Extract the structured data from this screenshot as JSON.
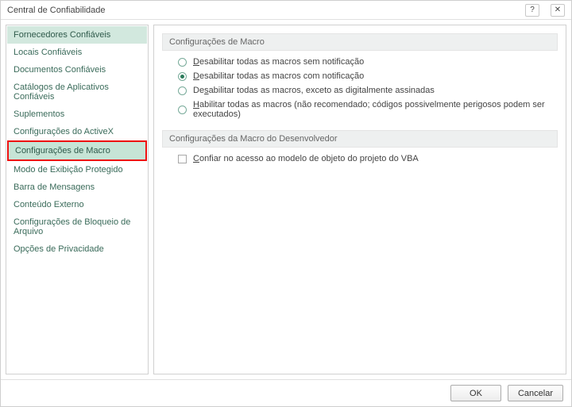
{
  "window": {
    "title": "Central de Confiabilidade",
    "help_icon": "?",
    "close_icon": "✕"
  },
  "sidebar": {
    "items": [
      {
        "label": "Fornecedores Confiáveis",
        "state": "active"
      },
      {
        "label": "Locais Confiáveis",
        "state": ""
      },
      {
        "label": "Documentos Confiáveis",
        "state": ""
      },
      {
        "label": "Catálogos de Aplicativos Confiáveis",
        "state": ""
      },
      {
        "label": "Suplementos",
        "state": ""
      },
      {
        "label": "Configurações do ActiveX",
        "state": ""
      },
      {
        "label": "Configurações de Macro",
        "state": "selected highlight"
      },
      {
        "label": "Modo de Exibição Protegido",
        "state": ""
      },
      {
        "label": "Barra de Mensagens",
        "state": ""
      },
      {
        "label": "Conteúdo Externo",
        "state": ""
      },
      {
        "label": "Configurações de Bloqueio de Arquivo",
        "state": ""
      },
      {
        "label": "Opções de Privacidade",
        "state": ""
      }
    ]
  },
  "main": {
    "section1_title": "Configurações de Macro",
    "radios": [
      {
        "pre": "",
        "accel": "D",
        "post": "esabilitar todas as macros sem notificação",
        "checked": false
      },
      {
        "pre": "",
        "accel": "D",
        "post": "esabilitar todas as macros com notificação",
        "checked": true
      },
      {
        "pre": "De",
        "accel": "s",
        "post": "abilitar todas as macros, exceto as digitalmente assinadas",
        "checked": false
      },
      {
        "pre": "",
        "accel": "H",
        "post": "abilitar todas as macros (não recomendado; códigos possivelmente perigosos podem ser executados)",
        "checked": false
      }
    ],
    "section2_title": "Configurações da Macro do Desenvolvedor",
    "checkbox": {
      "pre": "",
      "accel": "C",
      "post": "onfiar no acesso ao modelo de objeto do projeto do VBA",
      "checked": false
    }
  },
  "footer": {
    "ok": "OK",
    "cancel": "Cancelar"
  }
}
